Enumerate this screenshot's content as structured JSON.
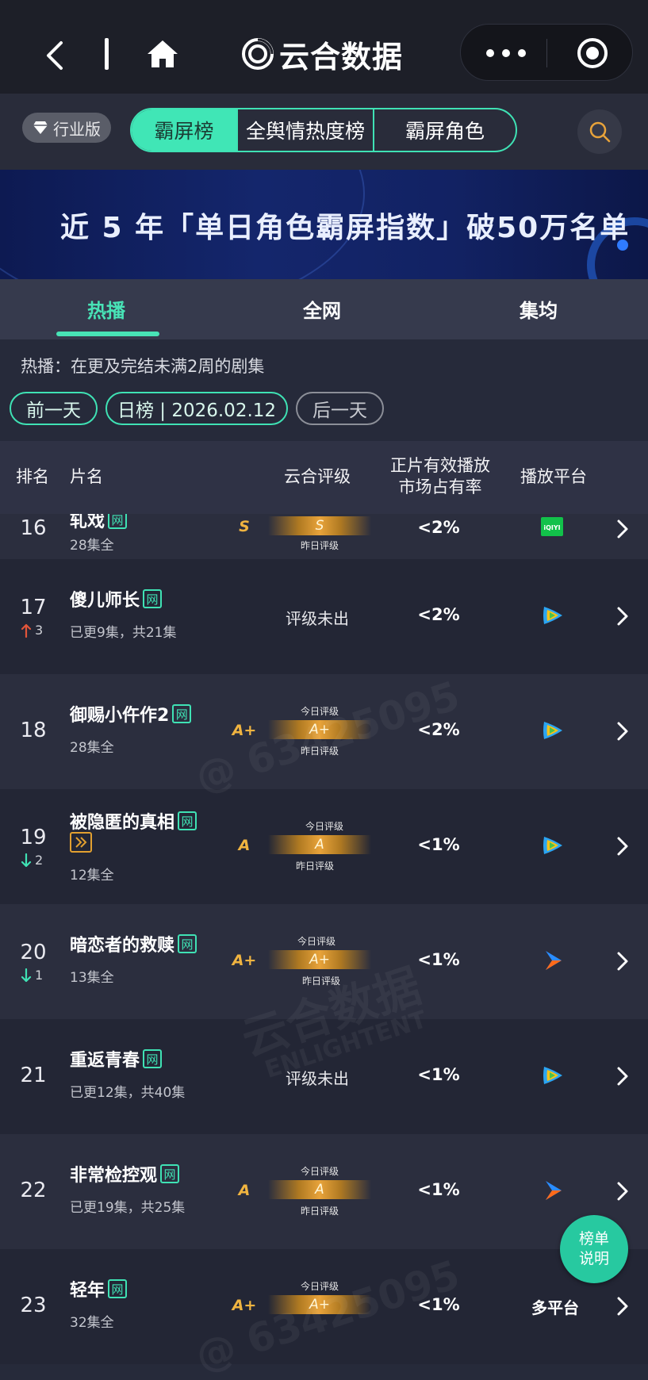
{
  "brand": {
    "name": "云合数据"
  },
  "tabstrip": {
    "edition": "行业版",
    "segments": [
      "霸屏榜",
      "全舆情热度榜",
      "霸屏角色"
    ]
  },
  "banner": {
    "text": "近 5 年「单日角色霸屏指数」破50万名单"
  },
  "subtabs": [
    "热播",
    "全网",
    "集均"
  ],
  "description": "热播：在更及完结未满2周的剧集",
  "date_nav": {
    "prev": "前一天",
    "current": "日榜 | 2026.02.12",
    "next": "后一天"
  },
  "table": {
    "headers": {
      "rank": "排名",
      "title": "片名",
      "grade": "云合评级",
      "share_line1": "正片有效播放",
      "share_line2": "市场占有率",
      "platform": "播放平台"
    },
    "grade_today_label": "今日评级",
    "grade_yesterday_label": "昨日评级",
    "net_badge": "网",
    "rows": [
      {
        "rank": "16",
        "title": "轧戏",
        "episodes": "28集全",
        "grade": "S",
        "grade_today": "S",
        "share": "<2%",
        "platform": "iqiyi",
        "delta": "",
        "delta_dir": ""
      },
      {
        "rank": "17",
        "title": "傻儿师长",
        "episodes": "已更9集，共21集",
        "grade": "评级未出",
        "grade_today": "",
        "share": "<2%",
        "platform": "tencent",
        "delta": "3",
        "delta_dir": "up"
      },
      {
        "rank": "18",
        "title": "御赐小仵作2",
        "episodes": "28集全",
        "grade": "A+",
        "grade_today": "A+",
        "share": "<2%",
        "platform": "tencent",
        "delta": "",
        "delta_dir": ""
      },
      {
        "rank": "19",
        "title": "被隐匿的真相",
        "episodes": "12集全",
        "grade": "A",
        "grade_today": "A",
        "share": "<1%",
        "platform": "tencent",
        "delta": "2",
        "delta_dir": "down"
      },
      {
        "rank": "20",
        "title": "暗恋者的救赎",
        "episodes": "13集全",
        "grade": "A+",
        "grade_today": "A+",
        "share": "<1%",
        "platform": "youku",
        "delta": "1",
        "delta_dir": "down"
      },
      {
        "rank": "21",
        "title": "重返青春",
        "episodes": "已更12集，共40集",
        "grade": "评级未出",
        "grade_today": "",
        "share": "<1%",
        "platform": "tencent",
        "delta": "",
        "delta_dir": ""
      },
      {
        "rank": "22",
        "title": "非常检控观",
        "episodes": "已更19集，共25集",
        "grade": "A",
        "grade_today": "A",
        "share": "<1%",
        "platform": "youku",
        "delta": "",
        "delta_dir": ""
      },
      {
        "rank": "23",
        "title": "轻年",
        "episodes": "32集全",
        "grade": "A+",
        "grade_today": "A+",
        "share": "<1%",
        "platform": "多平台",
        "delta": "",
        "delta_dir": ""
      }
    ]
  },
  "float_button": {
    "line1": "榜单",
    "line2": "说明"
  },
  "watermarks": [
    "@ 63425095",
    "云合数据",
    "ENLIGHTENT",
    "@ 63425095"
  ],
  "colors": {
    "accent": "#3fe2b4",
    "grade_gold": "#e8a33a",
    "up": "#e2553a",
    "down": "#3fe2b4"
  }
}
